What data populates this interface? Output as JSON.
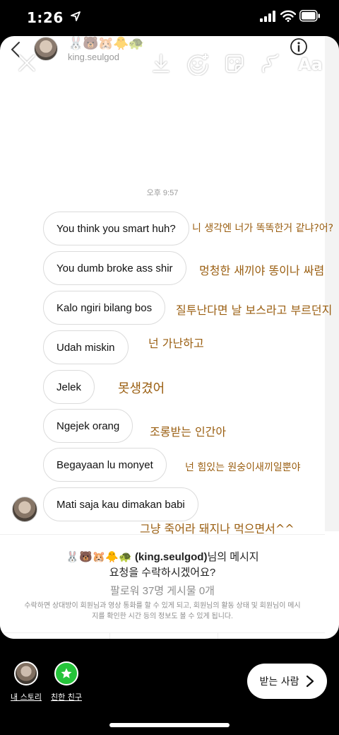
{
  "status_bar": {
    "time": "1:26"
  },
  "dm_header": {
    "emojis": "🐰🐻🐹🐥🐢",
    "username": "king.seulgod"
  },
  "story_tools": {
    "text_tool": "Aa"
  },
  "conversation": {
    "timestamp": "오후 9:57",
    "messages": [
      {
        "text": "You think you smart huh?",
        "translation": "니 생각엔 너가 똑똑한거 같냐?어?"
      },
      {
        "text": "You dumb broke ass shir",
        "translation": "멍청한 새끼야 똥이나 싸렴"
      },
      {
        "text": "Kalo ngiri bilang bos",
        "translation": "질투난다면 날 보스라고 부르던지"
      },
      {
        "text": "Udah miskin",
        "translation": "넌 가난하고"
      },
      {
        "text": "Jelek",
        "translation": "못생겼어"
      },
      {
        "text": "Ngejek orang",
        "translation": "조롱받는 인간아"
      },
      {
        "text": "Begayaan lu monyet",
        "translation": "넌 힘있는 원숭이새끼일뿐야"
      },
      {
        "text": "Mati saja kau dimakan babi",
        "translation": "그냥 죽어라 돼지나 먹으면서^^"
      }
    ]
  },
  "request": {
    "emojis": "🐰🐻🐹🐥🐢",
    "username": "(king.seulgod)",
    "line1_suffix": "님의 메시지",
    "line2": "요청을 수락하시겠어요?",
    "stats": "팔로워 37명 게시물 0개",
    "note": "수락하면 상대방이 회원님과 영상 통화를 할 수 있게 되고, 회원님의 활동 상태 및 회원님이 메시지를 확인한 시간 등의 정보도 볼 수 있게 됩니다."
  },
  "bottom_bar": {
    "my_story": "내 스토리",
    "close_friends": "친한 친구",
    "send_to": "받는 사람"
  },
  "colors": {
    "translation_text": "#9a5e10",
    "close_friends_green": "#25c43a",
    "bubble_border": "#dbdbdb"
  }
}
